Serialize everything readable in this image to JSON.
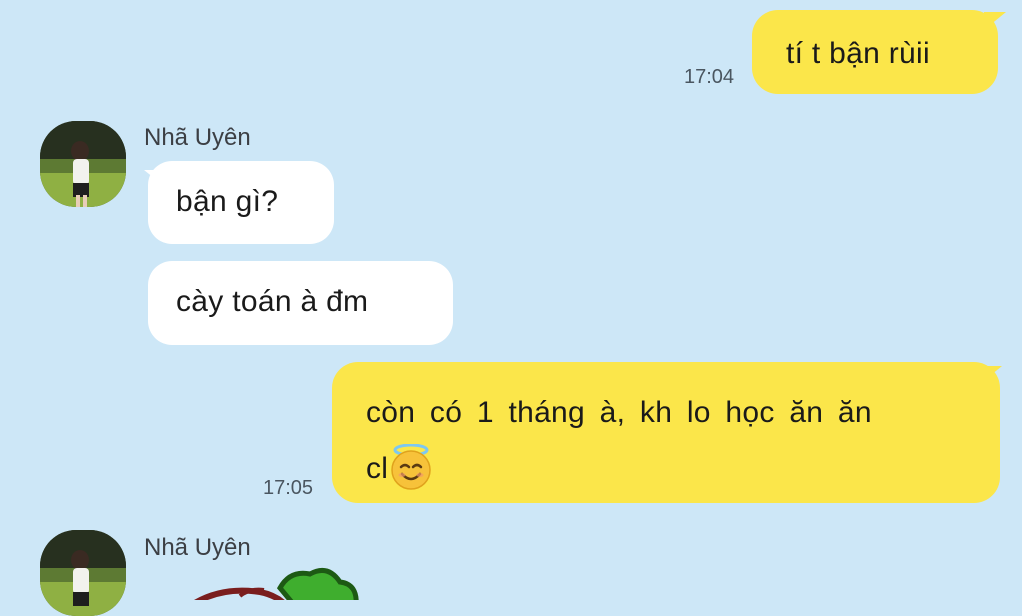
{
  "messages": [
    {
      "sender": "me",
      "text": "tí t bận rùii",
      "time": "17:04"
    },
    {
      "sender": "Nhã Uyên",
      "name": "Nhã Uyên",
      "text": "bận gì?"
    },
    {
      "sender": "Nhã Uyên",
      "text": "cày toán à đm"
    },
    {
      "sender": "me",
      "line1": "còn có 1 tháng à, kh lo học ăn ăn",
      "line2": "cl",
      "emoji": "smiling-face-with-halo-emoji",
      "time": "17:05"
    },
    {
      "sender": "Nhã Uyên",
      "name": "Nhã Uyên",
      "sticker": "sticker-image"
    }
  ],
  "colors": {
    "background": "#cde7f7",
    "my_bubble": "#fbe64a",
    "their_bubble": "#ffffff"
  }
}
